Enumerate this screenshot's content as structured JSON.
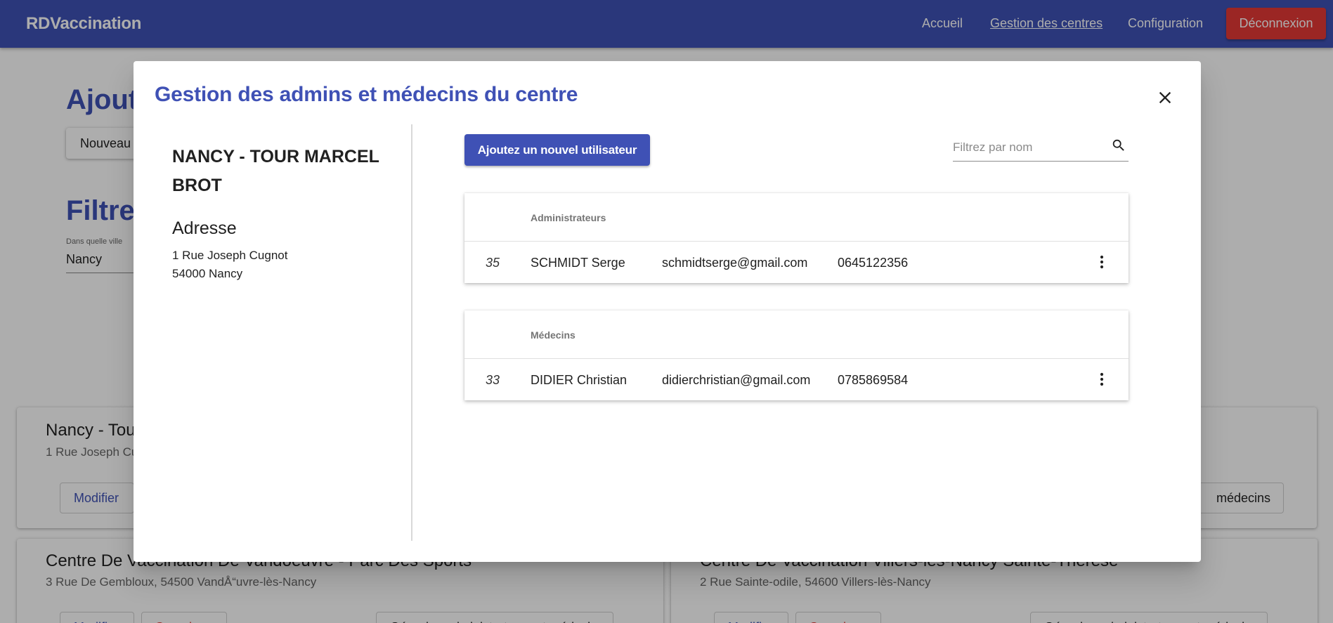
{
  "navbar": {
    "brand": "RDVaccination",
    "links": [
      {
        "label": "Accueil"
      },
      {
        "label": "Gestion des centres"
      },
      {
        "label": "Configuration"
      }
    ],
    "logout_label": "Déconnexion"
  },
  "background": {
    "heading_add": "Ajoutez",
    "new_button_label": "Nouveau c",
    "heading_filter": "Filtrez",
    "city_label": "Dans quelle ville",
    "city_value": "Nancy",
    "cards": [
      {
        "name": "Nancy - Tour",
        "address": "1 Rue Joseph Cu",
        "buttons": [
          "Modifier",
          "médecins"
        ]
      },
      {
        "name": "Centre De Vaccination De Vandoeuvre - Parc Des Sports",
        "address": "3 Rue De Gembloux, 54500 VandÅ“uvre-lès-Nancy",
        "buttons": [
          "Modifier",
          "Supprimer",
          "Gérer les administrateurs et médecins"
        ]
      },
      {
        "name": "Centre De Vaccination Villers-lès-Nancy Sainte-Thérèse",
        "address": "2 Rue Sainte-odile, 54600 Villers-lès-Nancy",
        "buttons": [
          "Modifier",
          "Supprimer",
          "Gérer les administrateurs et médecins"
        ]
      }
    ]
  },
  "modal": {
    "title": "Gestion des admins et médecins du centre",
    "center_name": "NANCY - TOUR MARCEL BROT",
    "address_heading": "Adresse",
    "address_line1": "1 Rue Joseph Cugnot",
    "address_line2": "54000 Nancy",
    "add_user_label": "Ajoutez un nouvel utilisateur",
    "filter_placeholder": "Filtrez par nom",
    "filter_value": "",
    "admins": {
      "header": "Administrateurs",
      "rows": [
        {
          "id": "35",
          "name": "SCHMIDT Serge",
          "email": "schmidtserge@gmail.com",
          "phone": "0645122356"
        }
      ]
    },
    "medecins": {
      "header": "Médecins",
      "rows": [
        {
          "id": "33",
          "name": "DIDIER Christian",
          "email": "didierchristian@gmail.com",
          "phone": "0785869584"
        }
      ]
    }
  },
  "colors": {
    "primary": "#3f51b5",
    "danger": "#e53935",
    "backdrop": "rgba(0,0,0,0.32)"
  },
  "icons": {
    "close": "close-icon",
    "search": "search-icon",
    "more": "more-vert-icon"
  }
}
